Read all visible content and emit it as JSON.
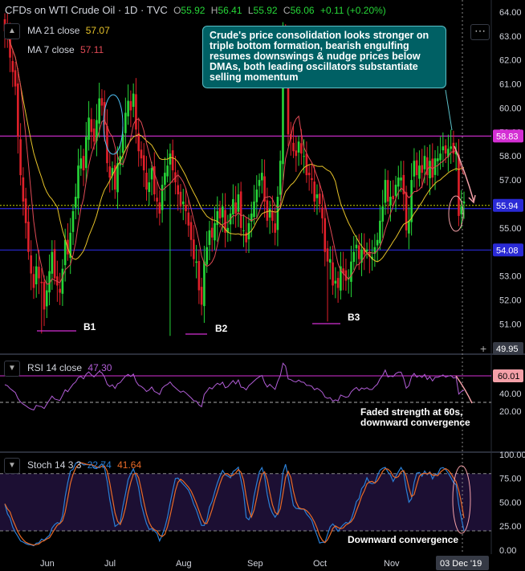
{
  "header": {
    "symbol_title": "CFDs on WTI Crude Oil · 1D · TVC",
    "open_label": "O",
    "open": "55.92",
    "high_label": "H",
    "high": "56.41",
    "low_label": "L",
    "low": "55.92",
    "close_label": "C",
    "close": "56.06",
    "change": "+0.11 (+0.20%)",
    "ma21_label": "MA 21 close",
    "ma21_value": "57.07",
    "ma7_label": "MA 7 close",
    "ma7_value": "57.11",
    "rsi_label": "RSI 14 close",
    "rsi_value": "47.30",
    "stoch_label": "Stoch 14 3 3",
    "stoch_k": "22.74",
    "stoch_d": "41.64",
    "menu_icon": "ellipsis-icon",
    "collapse_icon": "chevron-up-icon"
  },
  "annotations": {
    "callout": "Crude's price consolidation looks stronger on triple bottom formation, bearish engulfing resumes downswings & nudge prices below DMAs, both leading oscillators substantiate selling momentum",
    "rsi_note": "Faded strength at 60s, downward convergence",
    "stoch_note": "Downward convergence",
    "b1": "B1",
    "b2": "B2",
    "b3": "B3"
  },
  "colors": {
    "up": "#26d638",
    "down": "#e0202a",
    "ma21": "#e6c229",
    "ma7": "#e04a55",
    "level_magenta": "#d42fd4",
    "level_blue": "#2a2ad6",
    "rsi": "#b15dd6",
    "stoch_k": "#2a7fd6",
    "stoch_d": "#e86a28",
    "callout_bg": "#006064"
  },
  "chart_data": [
    {
      "type": "candlestick",
      "title": "CFDs on WTI Crude Oil · 1D · TVC",
      "x_ticks": [
        "Jun",
        "Jul",
        "Aug",
        "Sep",
        "Oct",
        "Nov"
      ],
      "last_date_label": "03 Dec '19",
      "y_ticks": [
        50.0,
        51.0,
        52.0,
        53.0,
        54.0,
        55.0,
        56.0,
        57.0,
        58.0,
        59.0,
        60.0,
        61.0,
        62.0,
        63.0,
        64.0
      ],
      "ylim": [
        49.4,
        64.3
      ],
      "last_price": 55.94,
      "right_axis_labels": [
        58.83,
        55.94,
        54.08,
        49.95
      ],
      "horizontal_levels": [
        58.83,
        55.94,
        54.08
      ],
      "bottoms": [
        {
          "label": "B1",
          "month": "Jun",
          "price": 50.6
        },
        {
          "label": "B2",
          "month": "Aug",
          "price": 50.5
        },
        {
          "label": "B3",
          "month": "Oct",
          "price": 51.1
        }
      ],
      "close_series": [
        63.2,
        62.9,
        62.1,
        61.5,
        60.9,
        58.8,
        57.2,
        56.1,
        55.2,
        54.0,
        53.1,
        52.5,
        53.4,
        52.9,
        52.7,
        51.6,
        52.4,
        53.2,
        54.0,
        52.9,
        52.6,
        52.3,
        53.3,
        54.5,
        53.9,
        54.8,
        55.7,
        56.3,
        57.6,
        57.9,
        57.4,
        58.8,
        59.6,
        59.0,
        58.6,
        59.5,
        60.4,
        60.1,
        59.3,
        57.7,
        57.1,
        57.5,
        56.6,
        57.7,
        58.0,
        58.9,
        59.8,
        60.3,
        59.9,
        60.6,
        59.1,
        58.2,
        57.9,
        57.4,
        56.6,
        56.9,
        57.5,
        56.4,
        56.1,
        55.6,
        56.8,
        57.3,
        57.6,
        58.1,
        57.4,
        56.9,
        56.4,
        55.9,
        56.1,
        55.7,
        55.1,
        54.5,
        53.7,
        53.6,
        52.4,
        51.8,
        53.6,
        54.2,
        54.9,
        54.6,
        55.2,
        55.7,
        55.4,
        55.9,
        54.8,
        55.0,
        55.6,
        56.2,
        55.6,
        56.4,
        55.0,
        54.9,
        54.4,
        55.2,
        55.6,
        56.1,
        56.6,
        57.0,
        57.3,
        56.1,
        55.3,
        55.8,
        55.3,
        54.8,
        56.3,
        57.8,
        62.9,
        62.3,
        58.9,
        58.7,
        58.2,
        58.0,
        58.6,
        58.1,
        58.0,
        57.2,
        57.2,
        57.0,
        56.1,
        56.4,
        56.0,
        55.4,
        54.0,
        53.6,
        53.7,
        52.6,
        52.8,
        52.5,
        53.4,
        53.1,
        52.8,
        52.9,
        53.6,
        54.0,
        54.3,
        53.7,
        54.1,
        53.9,
        54.1,
        53.8,
        53.8,
        54.2,
        54.5,
        55.3,
        55.9,
        57.0,
        56.1,
        56.3,
        56.2,
        56.8,
        57.1,
        57.1,
        56.4,
        54.9,
        55.3,
        57.0,
        57.8,
        57.2,
        57.6,
        57.3,
        58.0,
        57.2,
        57.8,
        57.1,
        57.9,
        57.9,
        58.1,
        58.4,
        58.1,
        58.3,
        58.4,
        58.1,
        58.2,
        55.5,
        55.9,
        56.1
      ],
      "ma21_note": "MA 21 close",
      "ma7_note": "MA 7 close"
    },
    {
      "type": "line",
      "title": "RSI 14 close",
      "y_ticks": [
        20.0,
        40.0,
        60.0
      ],
      "ylim": [
        17,
        78
      ],
      "upper_band_label": "60.01",
      "upper_band": 60,
      "lower_band": 30,
      "last_value": 47.3
    },
    {
      "type": "line",
      "title": "Stoch 14 3 3",
      "y_ticks": [
        0.0,
        25.0,
        50.0,
        75.0,
        100.0
      ],
      "ylim": [
        -4,
        104
      ],
      "upper_band": 80,
      "lower_band": 20,
      "last_k": 22.74,
      "last_d": 41.64
    }
  ]
}
